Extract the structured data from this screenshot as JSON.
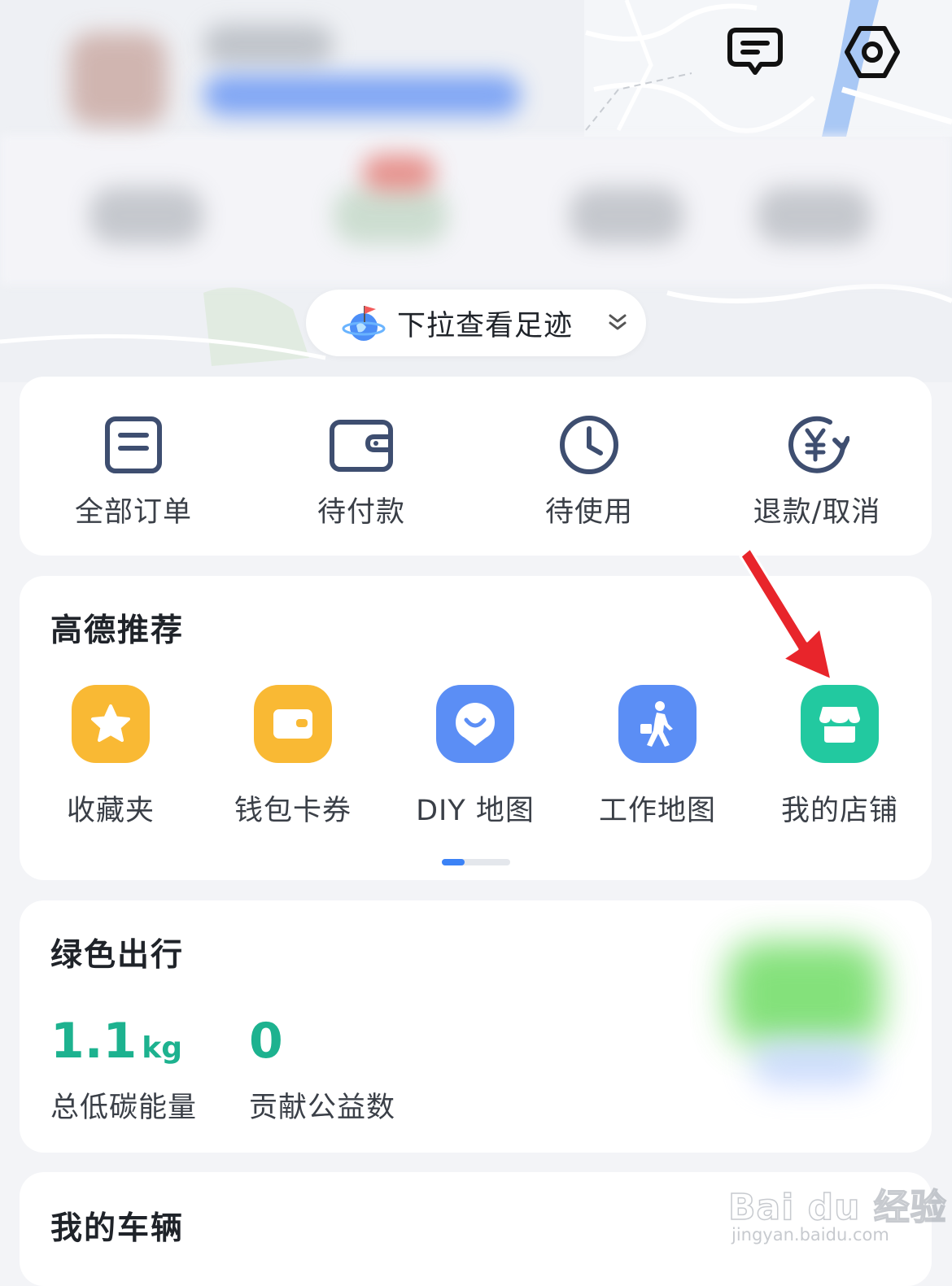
{
  "footprint": {
    "label": "下拉查看足迹"
  },
  "orders": [
    {
      "label": "全部订单",
      "icon": "order-list-icon"
    },
    {
      "label": "待付款",
      "icon": "wallet-icon"
    },
    {
      "label": "待使用",
      "icon": "clock-icon"
    },
    {
      "label": "退款/取消",
      "icon": "refund-yuan-icon"
    }
  ],
  "recommend": {
    "title": "高德推荐",
    "items": [
      {
        "label": "收藏夹",
        "icon": "star-icon",
        "color": "#f9b934"
      },
      {
        "label": "钱包卡券",
        "icon": "wallet-card-icon",
        "color": "#f9b934"
      },
      {
        "label": "DIY 地图",
        "icon": "map-pin-smile-icon",
        "color": "#5b8ef5"
      },
      {
        "label": "工作地图",
        "icon": "walking-briefcase-icon",
        "color": "#5b8ef5"
      },
      {
        "label": "我的店铺",
        "icon": "shop-icon",
        "color": "#22c9a0"
      }
    ],
    "page_index": 1,
    "page_count": 3
  },
  "green_travel": {
    "title": "绿色出行",
    "carbon": {
      "value": "1.1",
      "unit": "kg",
      "label": "总低碳能量"
    },
    "charity": {
      "value": "0",
      "label": "贡献公益数"
    }
  },
  "vehicles": {
    "title": "我的车辆"
  },
  "watermark": {
    "main": "Bai du 经验",
    "sub": "jingyan.baidu.com"
  },
  "colors": {
    "accent_green": "#1db28f",
    "accent_blue": "#3b82f6",
    "arrow_red": "#e8252b"
  }
}
